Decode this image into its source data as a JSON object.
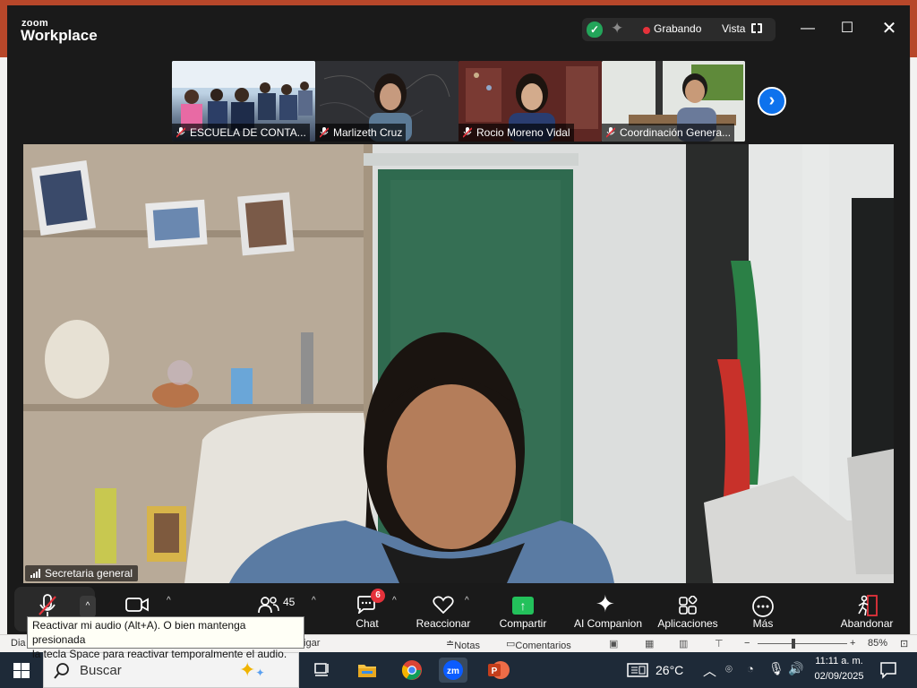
{
  "window": {
    "brand_small": "zoom",
    "brand_large": "Workplace",
    "recording_label": "Grabando",
    "view_label": "Vista"
  },
  "participants": [
    {
      "name": "ESCUELA DE CONTA...",
      "muted": true
    },
    {
      "name": "Marlizeth Cruz",
      "muted": true
    },
    {
      "name": "Rocio Moreno Vidal",
      "muted": true
    },
    {
      "name": "Coordinación Genera...",
      "muted": true
    }
  ],
  "main_speaker": {
    "name": "Secretaria general"
  },
  "toolbar": {
    "participants_count": "45",
    "chat_label": "Chat",
    "chat_badge": "6",
    "react_label": "Reaccionar",
    "share_label": "Compartir",
    "companion_label": "AI Companion",
    "apps_label": "Aplicaciones",
    "more_label": "Más",
    "leave_label": "Abandonar"
  },
  "tooltip": {
    "line1": "Reactivar mi audio (Alt+A). O bien mantenga presionada",
    "line2": "la tecla Space para reactivar temporalmente el audio."
  },
  "ppt_status": {
    "left_cut": "Dia",
    "mitigar_cut": "tigar",
    "notes": "Notas",
    "comments": "Comentarios",
    "zoom_level": "85%"
  },
  "taskbar": {
    "search_placeholder": "Buscar",
    "temperature": "26°C",
    "time": "11:11 a. m.",
    "date": "02/09/2025"
  },
  "colors": {
    "zoom_blue": "#0e72ed",
    "recording_red": "#e5323b",
    "share_green": "#23c15b",
    "secure_green": "#23a55a",
    "ppt_orange": "#b7472a"
  }
}
